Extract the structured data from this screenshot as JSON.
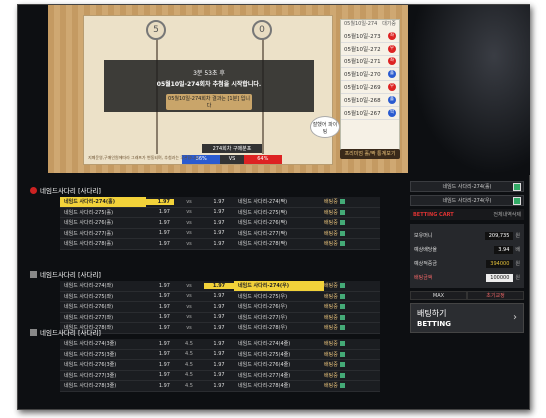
{
  "game": {
    "posts": [
      "5",
      "0"
    ],
    "overlay_line1": "3분 53초 후",
    "overlay_line2": "05월10일-274회차 추첨을 시작합니다.",
    "overlay_line3": "05월10일-274회차 결과는 [1분] 입니다",
    "bubble": "잘했어 파이팅",
    "vs_title": "274회차 구매분포",
    "left_pct": "36%",
    "vs": "VS",
    "right_pct": "64%",
    "caption": "지폐운영,구매인원에따라 그래프가 변동되며, 추첨과는 무관합니다."
  },
  "results": {
    "header_left": "05월10일-274",
    "header_right": "대기중",
    "rows": [
      {
        "label": "05월10일-273",
        "mark": "좌",
        "color": "#d22"
      },
      {
        "label": "05월10일-272",
        "mark": "우",
        "color": "#d22"
      },
      {
        "label": "05월10일-271",
        "mark": "좌",
        "color": "#d22"
      },
      {
        "label": "05월10일-270",
        "mark": "홀",
        "color": "#2a5bd0"
      },
      {
        "label": "05월10일-269",
        "mark": "우",
        "color": "#d22"
      },
      {
        "label": "05월10일-268",
        "mark": "홀",
        "color": "#2a5bd0"
      },
      {
        "label": "05월10일-267",
        "mark": "짝",
        "color": "#2a5bd0"
      }
    ],
    "button": "프리미엄 홀/짝 통계보기"
  },
  "sections": [
    {
      "title": "네임드사다리 [사다리]",
      "rows": [
        {
          "l": "네임드 사다리-274(홀)",
          "lo": "1.97",
          "m": "vs",
          "ro": "1.97",
          "r": "네임드 사다리-274(짝)",
          "bet": "배팅중",
          "hl": "left"
        },
        {
          "l": "네임드 사다리-275(홀)",
          "lo": "1.97",
          "m": "vs",
          "ro": "1.97",
          "r": "네임드 사다리-275(짝)",
          "bet": "배팅중",
          "hl": ""
        },
        {
          "l": "네임드 사다리-276(홀)",
          "lo": "1.97",
          "m": "vs",
          "ro": "1.97",
          "r": "네임드 사다리-276(짝)",
          "bet": "배팅중",
          "hl": ""
        },
        {
          "l": "네임드 사다리-277(홀)",
          "lo": "1.97",
          "m": "vs",
          "ro": "1.97",
          "r": "네임드 사다리-277(짝)",
          "bet": "배팅중",
          "hl": ""
        },
        {
          "l": "네임드 사다리-278(홀)",
          "lo": "1.97",
          "m": "vs",
          "ro": "1.97",
          "r": "네임드 사다리-278(짝)",
          "bet": "배팅중",
          "hl": ""
        }
      ]
    },
    {
      "title": "네임드사다리 [사다리]",
      "rows": [
        {
          "l": "네임드 사다리-274(좌)",
          "lo": "1.97",
          "m": "vs",
          "ro": "1.97",
          "r": "네임드 사다리-274(우)",
          "bet": "배팅중",
          "hl": "right"
        },
        {
          "l": "네임드 사다리-275(좌)",
          "lo": "1.97",
          "m": "vs",
          "ro": "1.97",
          "r": "네임드 사다리-275(우)",
          "bet": "배팅중",
          "hl": ""
        },
        {
          "l": "네임드 사다리-276(좌)",
          "lo": "1.97",
          "m": "vs",
          "ro": "1.97",
          "r": "네임드 사다리-276(우)",
          "bet": "배팅중",
          "hl": ""
        },
        {
          "l": "네임드 사다리-277(좌)",
          "lo": "1.97",
          "m": "vs",
          "ro": "1.97",
          "r": "네임드 사다리-277(우)",
          "bet": "배팅중",
          "hl": ""
        },
        {
          "l": "네임드 사다리-278(좌)",
          "lo": "1.97",
          "m": "vs",
          "ro": "1.97",
          "r": "네임드 사다리-278(우)",
          "bet": "배팅중",
          "hl": ""
        }
      ]
    },
    {
      "title": "네임드사다리 [사다리]",
      "rows": [
        {
          "l": "네임드 사다리-274(3줄)",
          "lo": "1.97",
          "m": "4.5",
          "ro": "1.97",
          "r": "네임드 사다리-274(4줄)",
          "bet": "배팅중",
          "hl": ""
        },
        {
          "l": "네임드 사다리-275(3줄)",
          "lo": "1.97",
          "m": "4.5",
          "ro": "1.97",
          "r": "네임드 사다리-275(4줄)",
          "bet": "배팅중",
          "hl": ""
        },
        {
          "l": "네임드 사다리-276(3줄)",
          "lo": "1.97",
          "m": "4.5",
          "ro": "1.97",
          "r": "네임드 사다리-276(4줄)",
          "bet": "배팅중",
          "hl": ""
        },
        {
          "l": "네임드 사다리-277(3줄)",
          "lo": "1.97",
          "m": "4.5",
          "ro": "1.97",
          "r": "네임드 사다리-277(4줄)",
          "bet": "배팅중",
          "hl": ""
        },
        {
          "l": "네임드 사다리-278(3줄)",
          "lo": "1.97",
          "m": "4.5",
          "ro": "1.97",
          "r": "네임드 사다리-278(4줄)",
          "bet": "배팅중",
          "hl": ""
        }
      ]
    }
  ],
  "right": {
    "pick1": "네임드 사다리-274(홀)",
    "pick2": "네임드 사다리-274(우)",
    "cart_title": "BETTING CART",
    "cart_clear": "전체내역삭제",
    "rows": [
      {
        "label": "보유머니",
        "value": "209,735",
        "unit": "원"
      },
      {
        "label": "예상배당율",
        "value": "3.94",
        "unit": "배"
      },
      {
        "label": "예상적중금",
        "value": "394000",
        "unit": "원"
      },
      {
        "label": "배팅금액",
        "value": "100000",
        "unit": "원"
      }
    ],
    "max": "MAX",
    "reset": "초기교정",
    "bet_kr": "배팅하기",
    "bet_en": "BETTING",
    "arrow": "›"
  }
}
